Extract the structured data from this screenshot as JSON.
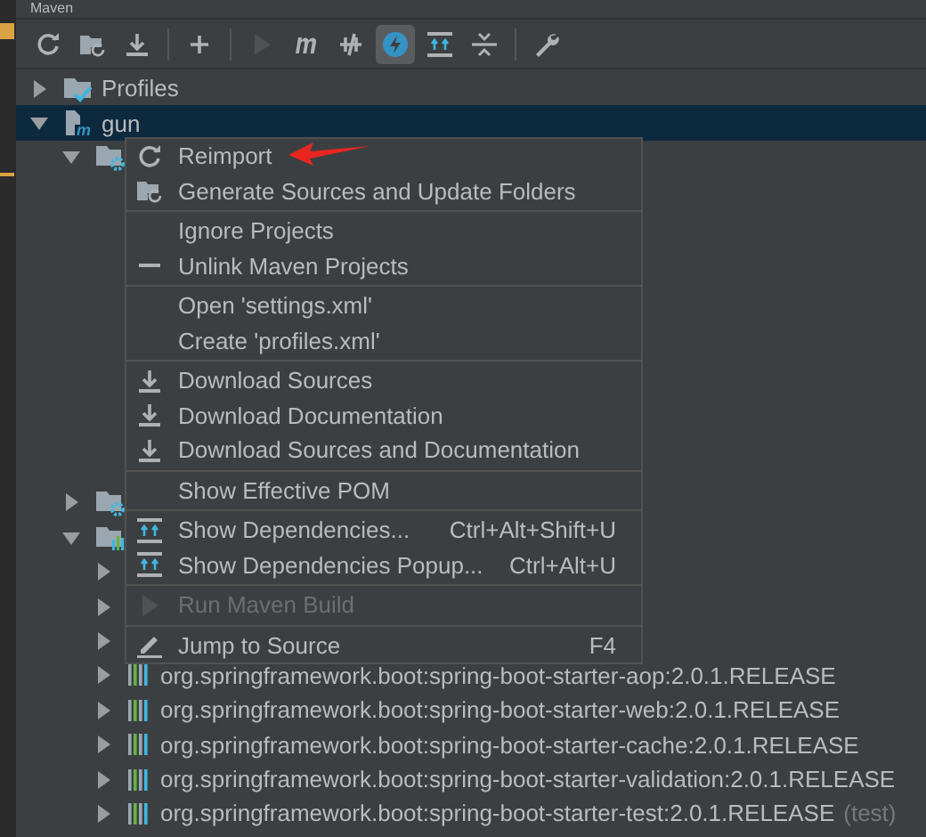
{
  "window": {
    "title": "Maven"
  },
  "toolbar": [
    {
      "kind": "refresh",
      "selected": false,
      "disabled": false
    },
    {
      "kind": "folder-refresh",
      "selected": false,
      "disabled": false
    },
    {
      "kind": "download",
      "selected": false,
      "disabled": false
    },
    {
      "kind": "sep"
    },
    {
      "kind": "plus",
      "selected": false,
      "disabled": false
    },
    {
      "kind": "sep"
    },
    {
      "kind": "run",
      "selected": false,
      "disabled": true
    },
    {
      "kind": "m",
      "selected": false,
      "disabled": false
    },
    {
      "kind": "skip",
      "selected": false,
      "disabled": false
    },
    {
      "kind": "bolt",
      "selected": true,
      "disabled": false
    },
    {
      "kind": "deps",
      "selected": false,
      "disabled": false
    },
    {
      "kind": "collapse",
      "selected": false,
      "disabled": false
    },
    {
      "kind": "sep"
    },
    {
      "kind": "wrench",
      "selected": false,
      "disabled": false
    }
  ],
  "tree": [
    {
      "label": "Profiles",
      "kind": "profiles",
      "expanded": false,
      "selected": false
    },
    {
      "label": "gun",
      "kind": "module",
      "expanded": true,
      "selected": true,
      "children": [
        {
          "kind": "gearfolder",
          "expanded": true,
          "children": [
            {
              "kind": "sliver"
            },
            {
              "kind": "sliver"
            },
            {
              "kind": "sliver"
            },
            {
              "kind": "sliver"
            },
            {
              "kind": "sliver"
            },
            {
              "kind": "sliver"
            },
            {
              "kind": "sliver"
            },
            {
              "kind": "sliver"
            },
            {
              "kind": "sliver"
            }
          ]
        },
        {
          "kind": "gearfolder",
          "expanded": false
        },
        {
          "kind": "depsfolder",
          "expanded": true,
          "children": [
            {
              "kind": "libpart",
              "expanded": false
            },
            {
              "kind": "libpart",
              "expanded": false
            },
            {
              "kind": "libpart",
              "expanded": false
            },
            {
              "label": "org.springframework.boot:spring-boot-starter-aop:2.0.1.RELEASE",
              "kind": "lib",
              "expanded": false,
              "selected": false
            },
            {
              "label": "org.springframework.boot:spring-boot-starter-web:2.0.1.RELEASE",
              "kind": "lib",
              "expanded": false,
              "selected": false
            },
            {
              "label": "org.springframework.boot:spring-boot-starter-cache:2.0.1.RELEASE",
              "kind": "lib",
              "expanded": false,
              "selected": false
            },
            {
              "label": "org.springframework.boot:spring-boot-starter-validation:2.0.1.RELEASE",
              "kind": "lib",
              "expanded": false,
              "selected": false
            },
            {
              "label": "org.springframework.boot:spring-boot-starter-test:2.0.1.RELEASE",
              "note": "(test)",
              "kind": "lib",
              "expanded": false,
              "selected": false
            }
          ]
        }
      ]
    }
  ],
  "context_menu": [
    [
      {
        "label": "Reimport",
        "kind": "refresh",
        "disabled": false
      },
      {
        "label": "Generate Sources and Update Folders",
        "kind": "folder-refresh",
        "disabled": false
      }
    ],
    [
      {
        "label": "Ignore Projects",
        "kind": "plain",
        "disabled": false
      },
      {
        "label": "Unlink Maven Projects",
        "kind": "minus",
        "disabled": false
      }
    ],
    [
      {
        "label": "Open 'settings.xml'",
        "kind": "plain",
        "disabled": false
      },
      {
        "label": "Create 'profiles.xml'",
        "kind": "plain",
        "disabled": false
      }
    ],
    [
      {
        "label": "Download Sources",
        "kind": "download",
        "disabled": false
      },
      {
        "label": "Download Documentation",
        "kind": "download",
        "disabled": false
      },
      {
        "label": "Download Sources and Documentation",
        "kind": "download",
        "disabled": false
      }
    ],
    [
      {
        "label": "Show Effective POM",
        "kind": "plain",
        "disabled": false
      }
    ],
    [
      {
        "label": "Show Dependencies...",
        "kind": "deps",
        "shortcut": "Ctrl+Alt+Shift+U",
        "disabled": false
      },
      {
        "label": "Show Dependencies Popup...",
        "kind": "deps",
        "shortcut": "Ctrl+Alt+U",
        "disabled": false
      }
    ],
    [
      {
        "label": "Run Maven Build",
        "kind": "run",
        "disabled": true
      }
    ],
    [
      {
        "label": "Jump to Source",
        "kind": "pencil",
        "shortcut": "F4",
        "disabled": false
      }
    ]
  ],
  "annotation": {
    "kind": "arrow"
  }
}
